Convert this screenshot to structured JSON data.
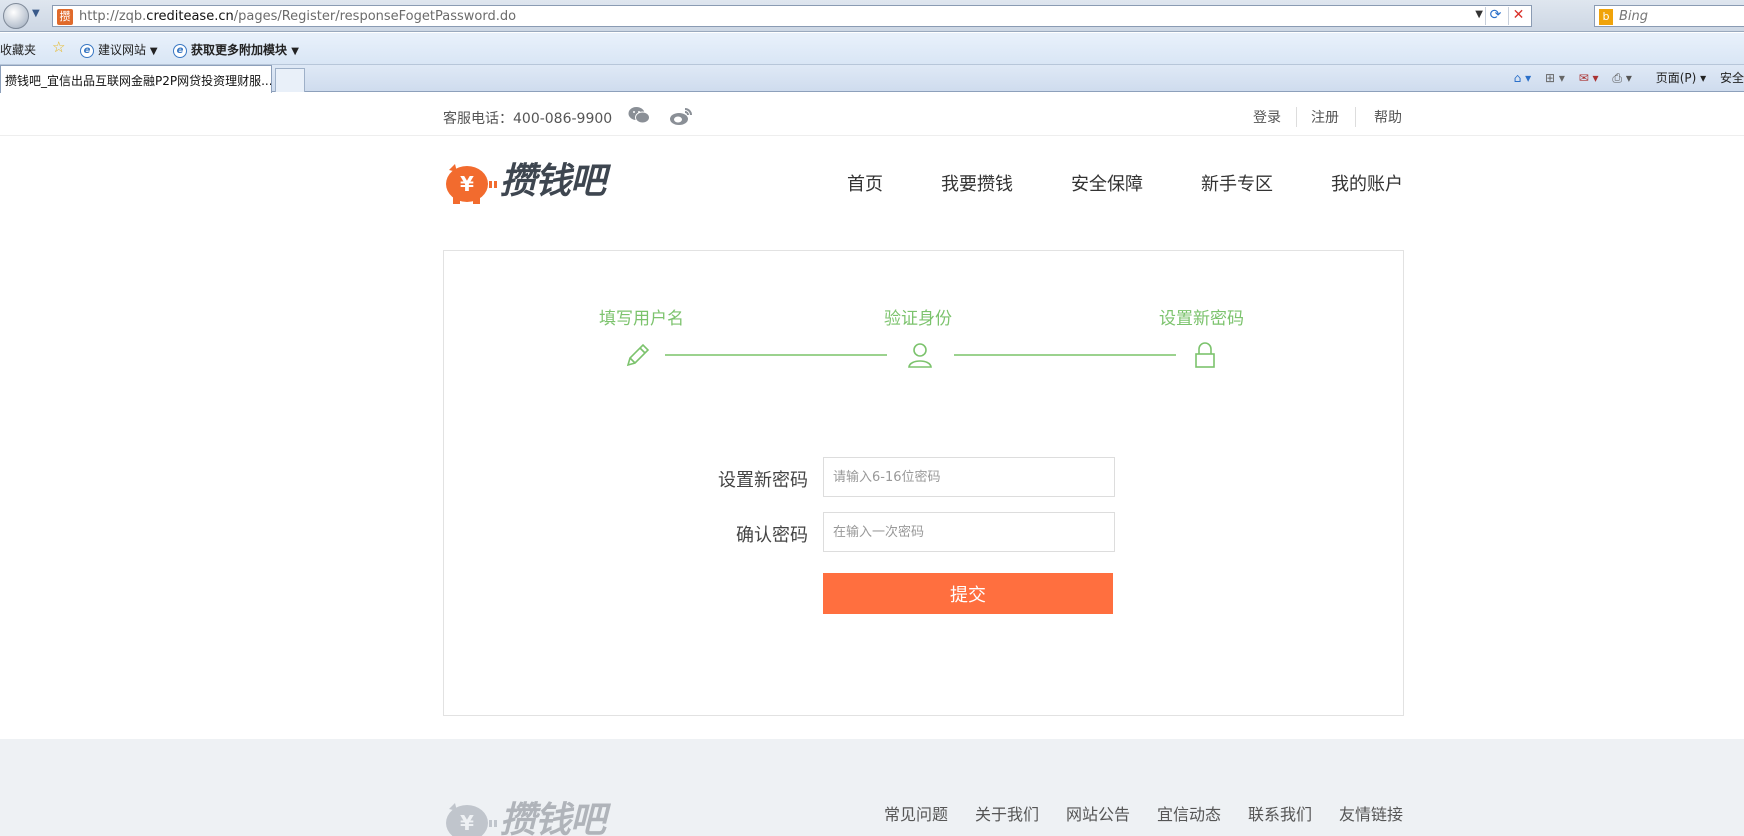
{
  "browser": {
    "url_prefix": "http://zqb.",
    "url_domain": "creditease.cn",
    "url_path": "/pages/Register/responseFogetPassword.do",
    "search_engine": "Bing",
    "favorites_label": "收藏夹",
    "fav_items": [
      "建议网站",
      "获取更多附加模块"
    ],
    "tab_title": "攒钱吧_宜信出品互联网金融P2P网贷投资理财服...",
    "cmd_items": [
      "页面(P)",
      "安全"
    ],
    "favicon_glyph": "攒"
  },
  "topbar": {
    "hotline": "客服电话：400-086-9900",
    "links": [
      "登录",
      "注册",
      "帮助"
    ]
  },
  "logo": {
    "text": "攒钱吧",
    "coin": "¥"
  },
  "nav": [
    "首页",
    "我要攒钱",
    "安全保障",
    "新手专区",
    "我的账户"
  ],
  "steps": [
    "填写用户名",
    "验证身份",
    "设置新密码"
  ],
  "form": {
    "new_password_label": "设置新密码",
    "new_password_placeholder": "请输入6-16位密码",
    "confirm_label": "确认密码",
    "confirm_placeholder": "在输入一次密码",
    "submit_label": "提交"
  },
  "footer": {
    "links": [
      "常见问题",
      "关于我们",
      "网站公告",
      "宜信动态",
      "联系我们",
      "友情链接"
    ]
  },
  "colors": {
    "accent": "#ff6f3f",
    "step_green": "#7cc36d"
  }
}
